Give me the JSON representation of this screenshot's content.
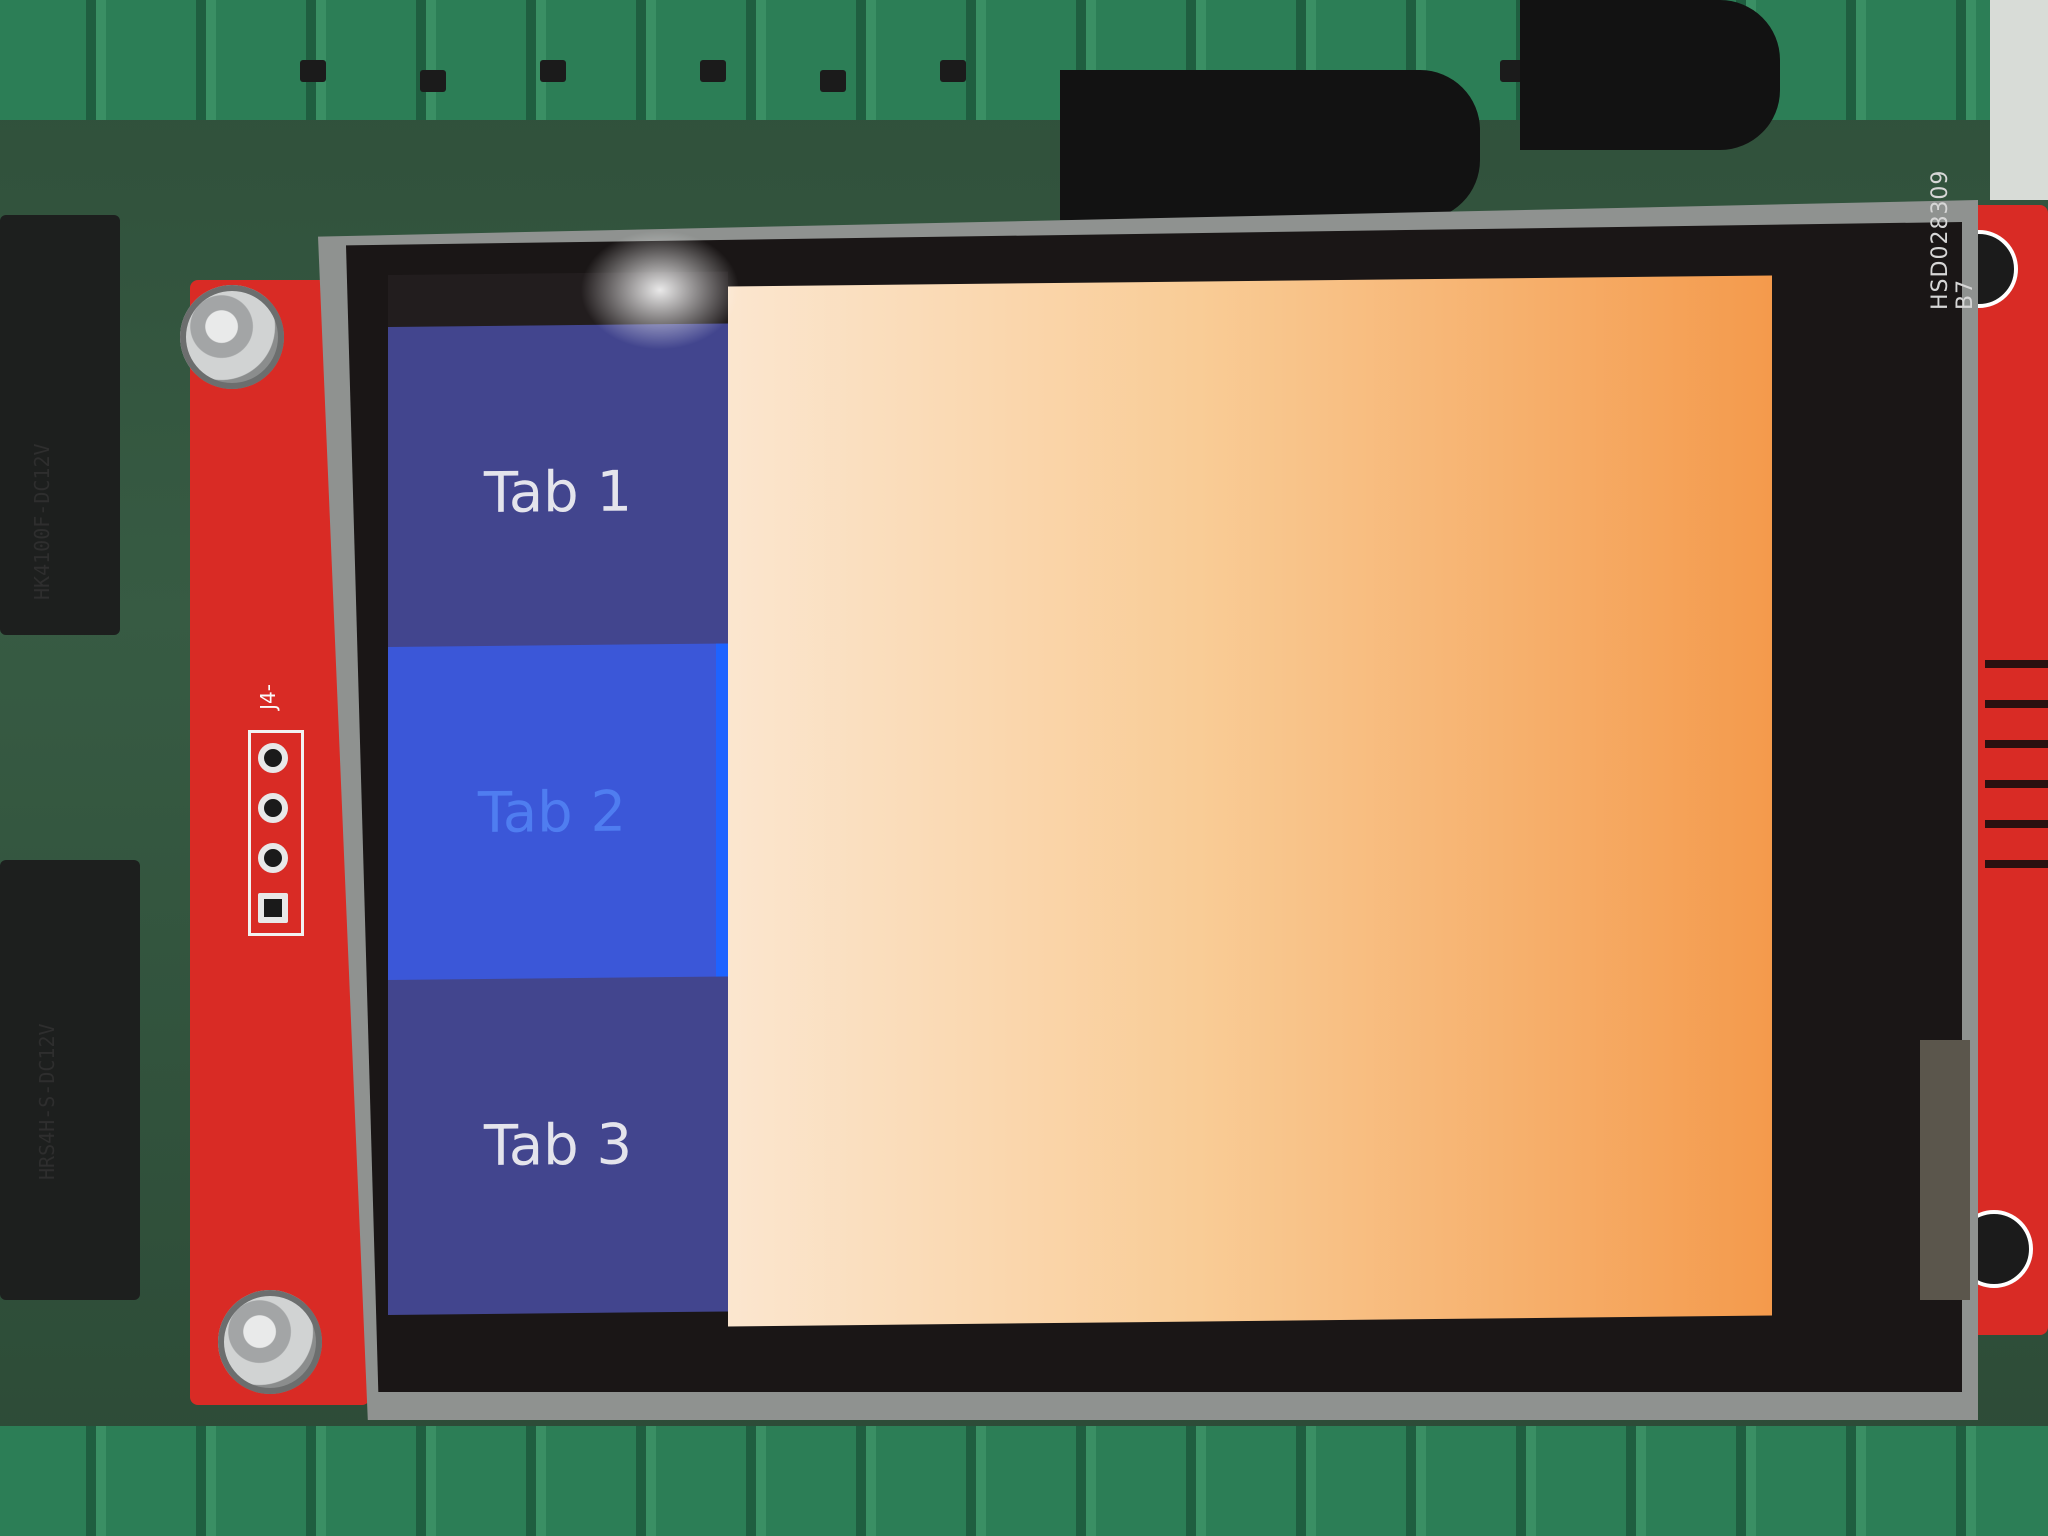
{
  "screen": {
    "tabs": [
      {
        "label": "Tab 1",
        "selected": false
      },
      {
        "label": "Tab 2",
        "selected": true
      },
      {
        "label": "Tab 3",
        "selected": false
      }
    ],
    "content_gradient": [
      "#fbe6cf",
      "#f9cc96",
      "#f49a4c"
    ],
    "tab_color": "#42458e",
    "selected_tab_color": "#3b57d8"
  },
  "hardware": {
    "module_label": "HSD028309  B7",
    "header_label": "J4-",
    "relay_top_label": "HK4100F-DC12V",
    "relay_bottom_label": "HRS4H-S-DC12V"
  }
}
